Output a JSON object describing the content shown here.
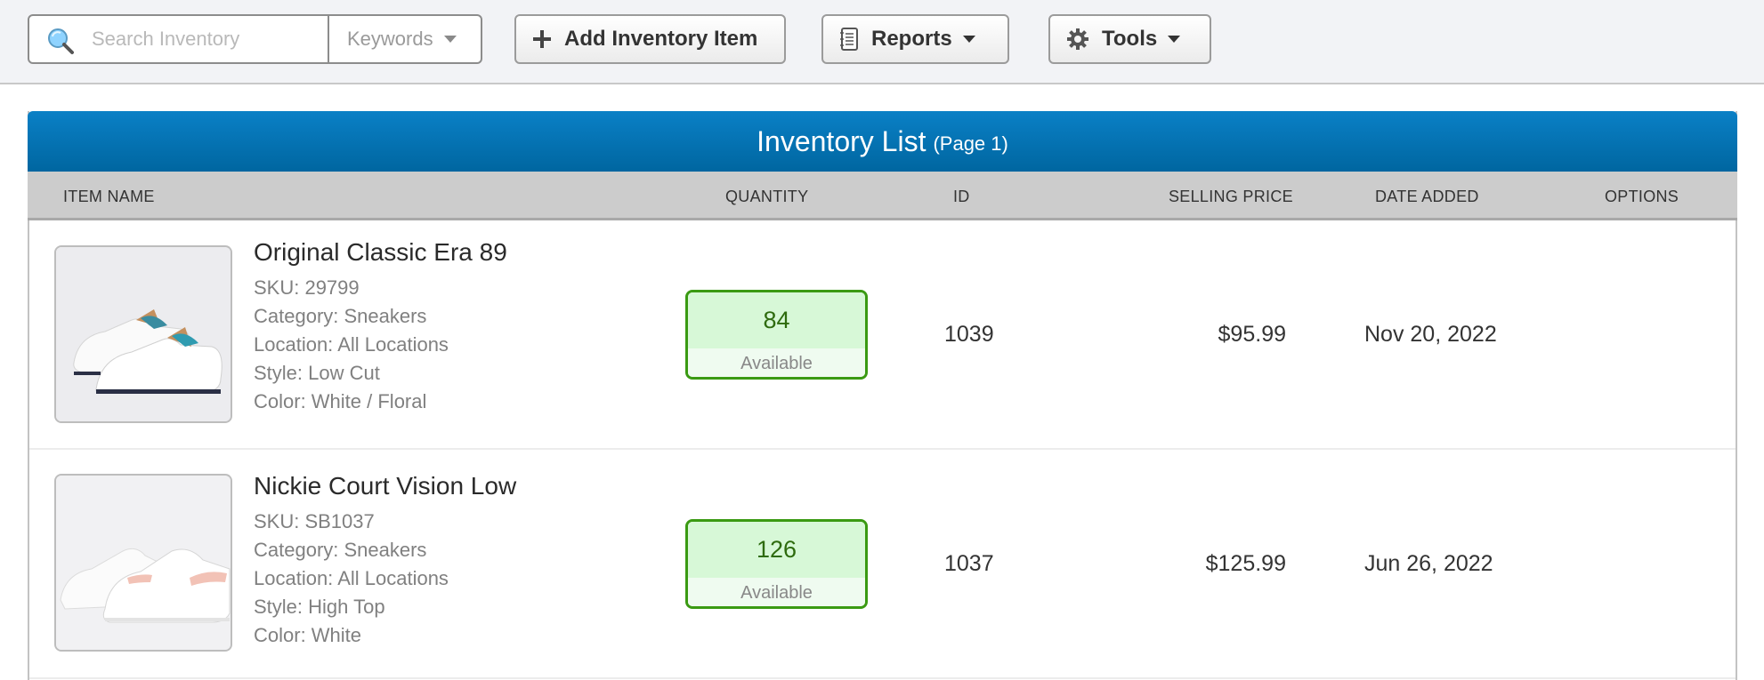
{
  "toolbar": {
    "search": {
      "placeholder": "Search Inventory",
      "value": "",
      "filter_selected": "Keywords"
    },
    "add_label": "Add Inventory Item",
    "reports_label": "Reports",
    "tools_label": "Tools"
  },
  "panel": {
    "title": "Inventory List",
    "subtitle": "(Page 1)",
    "columns": [
      "ITEM NAME",
      "QUANTITY",
      "ID",
      "SELLING PRICE",
      "DATE ADDED",
      "OPTIONS"
    ]
  },
  "items": [
    {
      "name": "Original Classic Era 89",
      "sku": "SKU: 29799",
      "category": "Category: Sneakers",
      "location": "Location: All Locations",
      "style": "Style: Low Cut",
      "color": "Color: White / Floral",
      "quantity": "84",
      "quantity_status": "Available",
      "id": "1039",
      "price": "$95.99",
      "date_added": "Nov 20, 2022"
    },
    {
      "name": "Nickie Court Vision Low",
      "sku": "SKU: SB1037",
      "category": "Category: Sneakers",
      "location": "Location: All Locations",
      "style": "Style: High Top",
      "color": "Color: White",
      "quantity": "126",
      "quantity_status": "Available",
      "id": "1037",
      "price": "$125.99",
      "date_added": "Jun 26, 2022"
    }
  ],
  "colors": {
    "header_blue": "#0a80c6",
    "available_border": "#3a9a12",
    "available_bg": "#d7f8d7"
  }
}
